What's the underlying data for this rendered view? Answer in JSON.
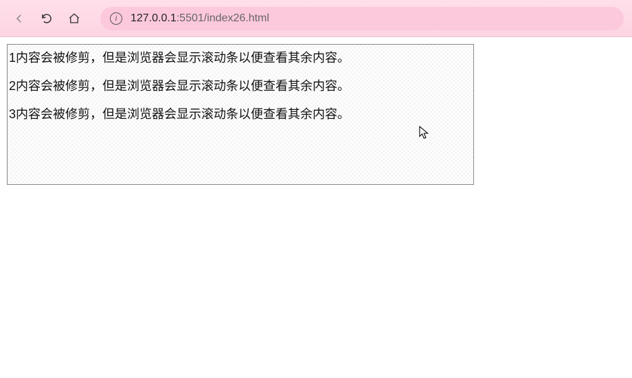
{
  "browser": {
    "url_host": "127.0.0.1",
    "url_port_path": ":5501/index26.html",
    "info_glyph": "i"
  },
  "content": {
    "lines": [
      "1内容会被修剪，但是浏览器会显示滚动条以便查看其余内容。",
      "2内容会被修剪，但是浏览器会显示滚动条以便查看其余内容。",
      "3内容会被修剪，但是浏览器会显示滚动条以便查看其余内容。"
    ]
  }
}
